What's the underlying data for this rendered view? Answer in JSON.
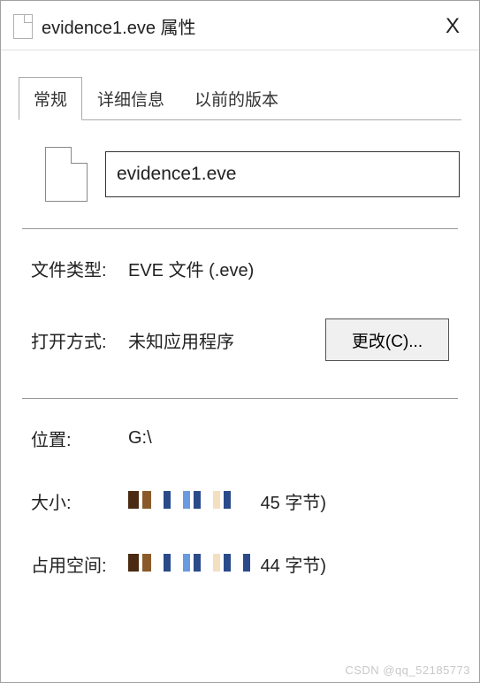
{
  "window": {
    "title": "evidence1.eve 属性",
    "close_glyph": "X"
  },
  "tabs": {
    "general": "常规",
    "details": "详细信息",
    "previous": "以前的版本"
  },
  "file": {
    "name_value": "evidence1.eve"
  },
  "labels": {
    "filetype": "文件类型:",
    "opens_with": "打开方式:",
    "location": "位置:",
    "size": "大小:",
    "size_on_disk": "占用空间:"
  },
  "values": {
    "filetype": "EVE 文件 (.eve)",
    "opens_with": "未知应用程序",
    "change_btn": "更改(C)...",
    "location": "G:\\",
    "size_suffix": "45 字节)",
    "size_on_disk_suffix": "44 字节)"
  },
  "watermark": "CSDN @qq_52185773"
}
